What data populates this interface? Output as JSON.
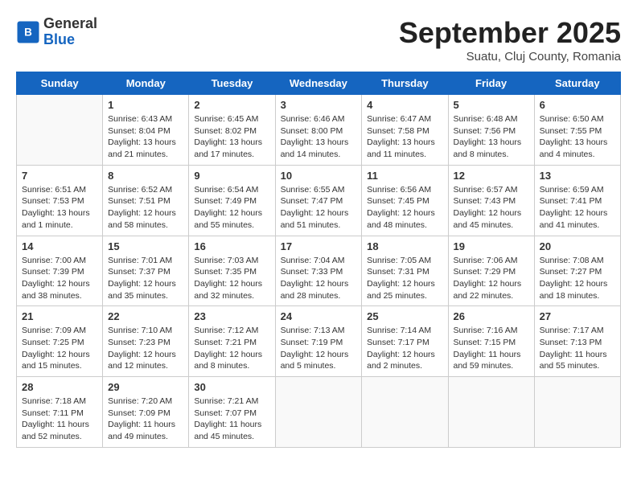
{
  "header": {
    "logo_general": "General",
    "logo_blue": "Blue",
    "month_title": "September 2025",
    "location": "Suatu, Cluj County, Romania"
  },
  "days_of_week": [
    "Sunday",
    "Monday",
    "Tuesday",
    "Wednesday",
    "Thursday",
    "Friday",
    "Saturday"
  ],
  "weeks": [
    [
      {
        "day": "",
        "info": ""
      },
      {
        "day": "1",
        "info": "Sunrise: 6:43 AM\nSunset: 8:04 PM\nDaylight: 13 hours\nand 21 minutes."
      },
      {
        "day": "2",
        "info": "Sunrise: 6:45 AM\nSunset: 8:02 PM\nDaylight: 13 hours\nand 17 minutes."
      },
      {
        "day": "3",
        "info": "Sunrise: 6:46 AM\nSunset: 8:00 PM\nDaylight: 13 hours\nand 14 minutes."
      },
      {
        "day": "4",
        "info": "Sunrise: 6:47 AM\nSunset: 7:58 PM\nDaylight: 13 hours\nand 11 minutes."
      },
      {
        "day": "5",
        "info": "Sunrise: 6:48 AM\nSunset: 7:56 PM\nDaylight: 13 hours\nand 8 minutes."
      },
      {
        "day": "6",
        "info": "Sunrise: 6:50 AM\nSunset: 7:55 PM\nDaylight: 13 hours\nand 4 minutes."
      }
    ],
    [
      {
        "day": "7",
        "info": "Sunrise: 6:51 AM\nSunset: 7:53 PM\nDaylight: 13 hours\nand 1 minute."
      },
      {
        "day": "8",
        "info": "Sunrise: 6:52 AM\nSunset: 7:51 PM\nDaylight: 12 hours\nand 58 minutes."
      },
      {
        "day": "9",
        "info": "Sunrise: 6:54 AM\nSunset: 7:49 PM\nDaylight: 12 hours\nand 55 minutes."
      },
      {
        "day": "10",
        "info": "Sunrise: 6:55 AM\nSunset: 7:47 PM\nDaylight: 12 hours\nand 51 minutes."
      },
      {
        "day": "11",
        "info": "Sunrise: 6:56 AM\nSunset: 7:45 PM\nDaylight: 12 hours\nand 48 minutes."
      },
      {
        "day": "12",
        "info": "Sunrise: 6:57 AM\nSunset: 7:43 PM\nDaylight: 12 hours\nand 45 minutes."
      },
      {
        "day": "13",
        "info": "Sunrise: 6:59 AM\nSunset: 7:41 PM\nDaylight: 12 hours\nand 41 minutes."
      }
    ],
    [
      {
        "day": "14",
        "info": "Sunrise: 7:00 AM\nSunset: 7:39 PM\nDaylight: 12 hours\nand 38 minutes."
      },
      {
        "day": "15",
        "info": "Sunrise: 7:01 AM\nSunset: 7:37 PM\nDaylight: 12 hours\nand 35 minutes."
      },
      {
        "day": "16",
        "info": "Sunrise: 7:03 AM\nSunset: 7:35 PM\nDaylight: 12 hours\nand 32 minutes."
      },
      {
        "day": "17",
        "info": "Sunrise: 7:04 AM\nSunset: 7:33 PM\nDaylight: 12 hours\nand 28 minutes."
      },
      {
        "day": "18",
        "info": "Sunrise: 7:05 AM\nSunset: 7:31 PM\nDaylight: 12 hours\nand 25 minutes."
      },
      {
        "day": "19",
        "info": "Sunrise: 7:06 AM\nSunset: 7:29 PM\nDaylight: 12 hours\nand 22 minutes."
      },
      {
        "day": "20",
        "info": "Sunrise: 7:08 AM\nSunset: 7:27 PM\nDaylight: 12 hours\nand 18 minutes."
      }
    ],
    [
      {
        "day": "21",
        "info": "Sunrise: 7:09 AM\nSunset: 7:25 PM\nDaylight: 12 hours\nand 15 minutes."
      },
      {
        "day": "22",
        "info": "Sunrise: 7:10 AM\nSunset: 7:23 PM\nDaylight: 12 hours\nand 12 minutes."
      },
      {
        "day": "23",
        "info": "Sunrise: 7:12 AM\nSunset: 7:21 PM\nDaylight: 12 hours\nand 8 minutes."
      },
      {
        "day": "24",
        "info": "Sunrise: 7:13 AM\nSunset: 7:19 PM\nDaylight: 12 hours\nand 5 minutes."
      },
      {
        "day": "25",
        "info": "Sunrise: 7:14 AM\nSunset: 7:17 PM\nDaylight: 12 hours\nand 2 minutes."
      },
      {
        "day": "26",
        "info": "Sunrise: 7:16 AM\nSunset: 7:15 PM\nDaylight: 11 hours\nand 59 minutes."
      },
      {
        "day": "27",
        "info": "Sunrise: 7:17 AM\nSunset: 7:13 PM\nDaylight: 11 hours\nand 55 minutes."
      }
    ],
    [
      {
        "day": "28",
        "info": "Sunrise: 7:18 AM\nSunset: 7:11 PM\nDaylight: 11 hours\nand 52 minutes."
      },
      {
        "day": "29",
        "info": "Sunrise: 7:20 AM\nSunset: 7:09 PM\nDaylight: 11 hours\nand 49 minutes."
      },
      {
        "day": "30",
        "info": "Sunrise: 7:21 AM\nSunset: 7:07 PM\nDaylight: 11 hours\nand 45 minutes."
      },
      {
        "day": "",
        "info": ""
      },
      {
        "day": "",
        "info": ""
      },
      {
        "day": "",
        "info": ""
      },
      {
        "day": "",
        "info": ""
      }
    ]
  ]
}
